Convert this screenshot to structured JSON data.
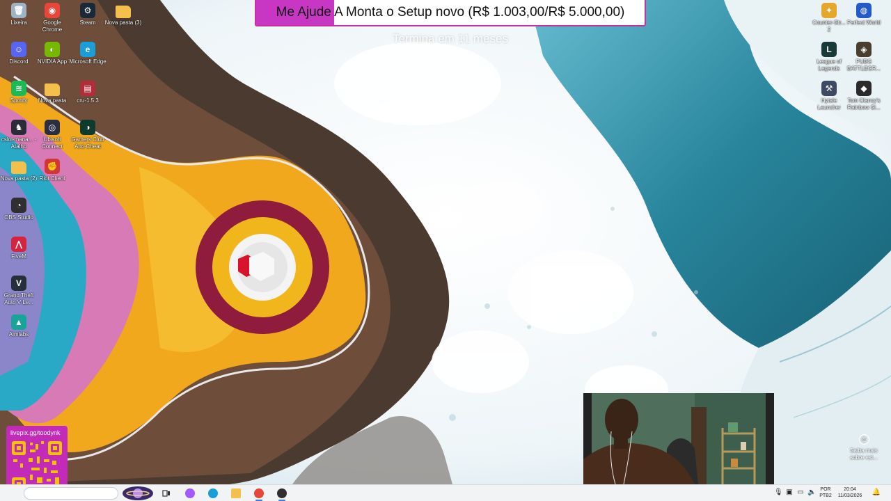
{
  "desktop_icons": [
    {
      "label": "Lixeira",
      "icon": "recycle-bin-icon",
      "color": "#9fb3c6",
      "glyph": "🗑"
    },
    {
      "label": "Google Chrome",
      "icon": "chrome-icon",
      "color": "#e8463a",
      "glyph": "◉"
    },
    {
      "label": "Steam",
      "icon": "steam-icon",
      "color": "#1b2838",
      "glyph": "⚙"
    },
    {
      "label": "Nova pasta (3)",
      "icon": "folder-icon",
      "color": "#f2c04b",
      "glyph": ""
    },
    {
      "label": "Discord",
      "icon": "discord-icon",
      "color": "#5865f2",
      "glyph": "☺"
    },
    {
      "label": "NVIDIA App",
      "icon": "nvidia-icon",
      "color": "#76b900",
      "glyph": "◐"
    },
    {
      "label": "Microsoft Edge",
      "icon": "edge-icon",
      "color": "#1a9ed9",
      "glyph": "e"
    },
    {
      "label": "Spotify",
      "icon": "spotify-icon",
      "color": "#1db954",
      "glyph": "≋"
    },
    {
      "label": "Nova pasta",
      "icon": "folder-icon",
      "color": "#f2c04b",
      "glyph": ""
    },
    {
      "label": "cru-1.5.3",
      "icon": "archive-icon",
      "color": "#b22c3a",
      "glyph": "▤"
    },
    {
      "label": "cslol-mana... - Atalho",
      "icon": "cslol-icon",
      "color": "#2b2b3a",
      "glyph": "♞"
    },
    {
      "label": "Ubisoft Connect",
      "icon": "ubisoft-icon",
      "color": "#2b2d42",
      "glyph": "◎"
    },
    {
      "label": "Gamers Club Anti-Cheat",
      "icon": "gamersclub-icon",
      "color": "#0f3b2e",
      "glyph": "◑"
    },
    {
      "label": "Nova pasta (2)",
      "icon": "folder-icon",
      "color": "#f2c04b",
      "glyph": ""
    },
    {
      "label": "Riot Client",
      "icon": "riot-icon",
      "color": "#d13639",
      "glyph": "✊"
    },
    {
      "label": "OBS Studio",
      "icon": "obs-icon",
      "color": "#302e31",
      "glyph": "◔"
    },
    {
      "label": "FiveM",
      "icon": "fivem-icon",
      "color": "#d6233f",
      "glyph": "⋀"
    },
    {
      "label": "Grand Theft Auto V Le...",
      "icon": "gta-icon",
      "color": "#26303a",
      "glyph": "V"
    },
    {
      "label": "Aimlabs",
      "icon": "aimlabs-icon",
      "color": "#1aa39a",
      "glyph": "▲"
    },
    {
      "label": "Counter-Str... 2",
      "icon": "cs2-icon",
      "color": "#e3a82b",
      "glyph": "✦"
    },
    {
      "label": "Perfect World",
      "icon": "perfectworld-icon",
      "color": "#2459c9",
      "glyph": "◍"
    },
    {
      "label": "League of Legends",
      "icon": "lol-icon",
      "color": "#1a3a3a",
      "glyph": "L"
    },
    {
      "label": "PUBG BATTLEGR...",
      "icon": "pubg-icon",
      "color": "#4a3f2e",
      "glyph": "◈"
    },
    {
      "label": "Hytale Launcher",
      "icon": "hytale-icon",
      "color": "#3c4b63",
      "glyph": "⚒"
    },
    {
      "label": "Tom Clancy's Rainbow Si...",
      "icon": "rainbow-six-icon",
      "color": "#2a2a2a",
      "glyph": "◆"
    }
  ],
  "goal": {
    "text": "Me Ajude A Monta o Setup novo (R$ 1.003,00/R$ 5.000,00)",
    "subtitle": "Termina em 11 meses",
    "progress": 0.2006,
    "fill_color": "#c836c4",
    "border_color": "#c2339e"
  },
  "qr": {
    "url": "livepix.gg/toodynk",
    "color": "#c22bb8"
  },
  "saiba": {
    "label": "Saiba mais sobre est..."
  },
  "taskbar": {
    "apps": [
      {
        "name": "copilot",
        "icon": "copilot-icon",
        "color": "#a259ff",
        "active": false
      },
      {
        "name": "edge",
        "icon": "edge-icon",
        "color": "#1a9ed9",
        "active": false
      },
      {
        "name": "file-explorer",
        "icon": "folder-icon",
        "color": "#f2c04b",
        "active": false
      },
      {
        "name": "chrome",
        "icon": "chrome-icon",
        "color": "#e8463a",
        "active": true
      },
      {
        "name": "obs",
        "icon": "obs-icon",
        "color": "#302e31",
        "active": true
      }
    ],
    "lang_line1": "POR",
    "lang_line2": "PTB2",
    "time": "20:04",
    "date": "11/03/2026"
  }
}
